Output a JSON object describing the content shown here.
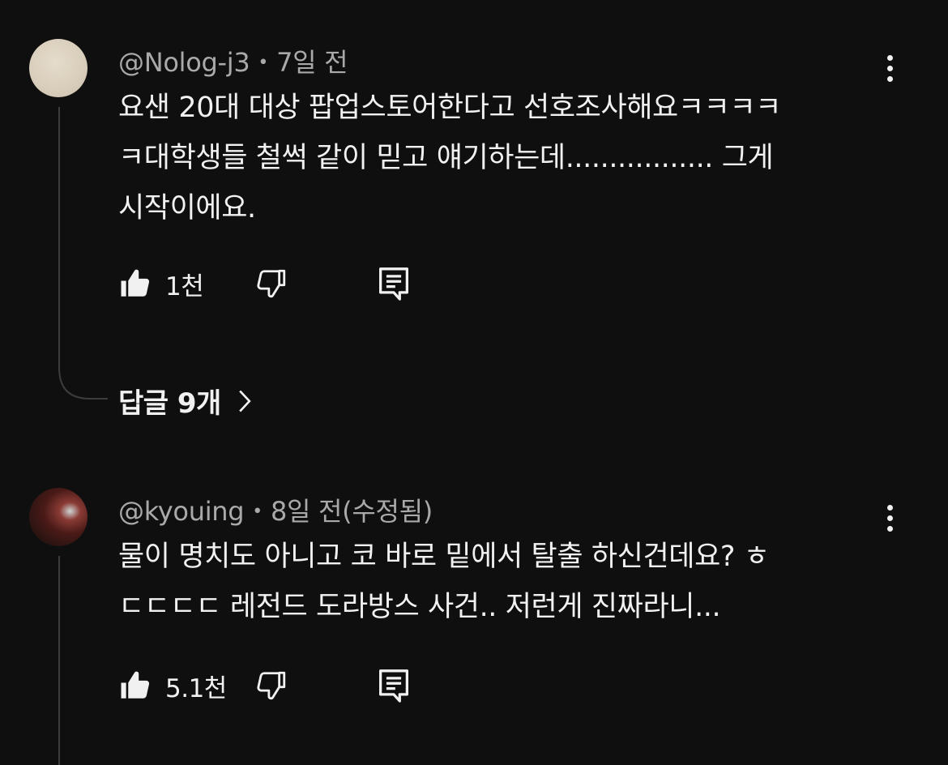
{
  "comments": [
    {
      "author": "@Nolog-j3",
      "time": "7일 전",
      "lines": [
        "요샌 20대 대상 팝업스토어한다고 선호조사해요ㅋㅋㅋㅋ",
        "ㅋ대학생들 철썩 같이 믿고 얘기하는데................. 그게",
        "시작이에요."
      ],
      "likes": "1천",
      "replies_label": "답글 9개"
    },
    {
      "author": "@kyouing",
      "time": "8일 전(수정됨)",
      "lines": [
        "물이 명치도 아니고 코 바로 밑에서 탈출 하신건데요? ㅎ",
        "ㄷㄷㄷㄷ 레전드 도라방스 사건.. 저런게 진짜라니..."
      ],
      "likes": "5.1천"
    }
  ],
  "separator": "•",
  "icons": {
    "like": "thumbs-up-icon",
    "dislike": "thumbs-down-icon",
    "reply": "comment-reply-icon",
    "more": "more-vertical-icon",
    "chevron": "chevron-right-icon"
  },
  "colors": {
    "background": "#0f0f0f",
    "text": "#f1f1f1",
    "meta": "#a9a9a9",
    "thread_line": "#3d3d3d"
  }
}
